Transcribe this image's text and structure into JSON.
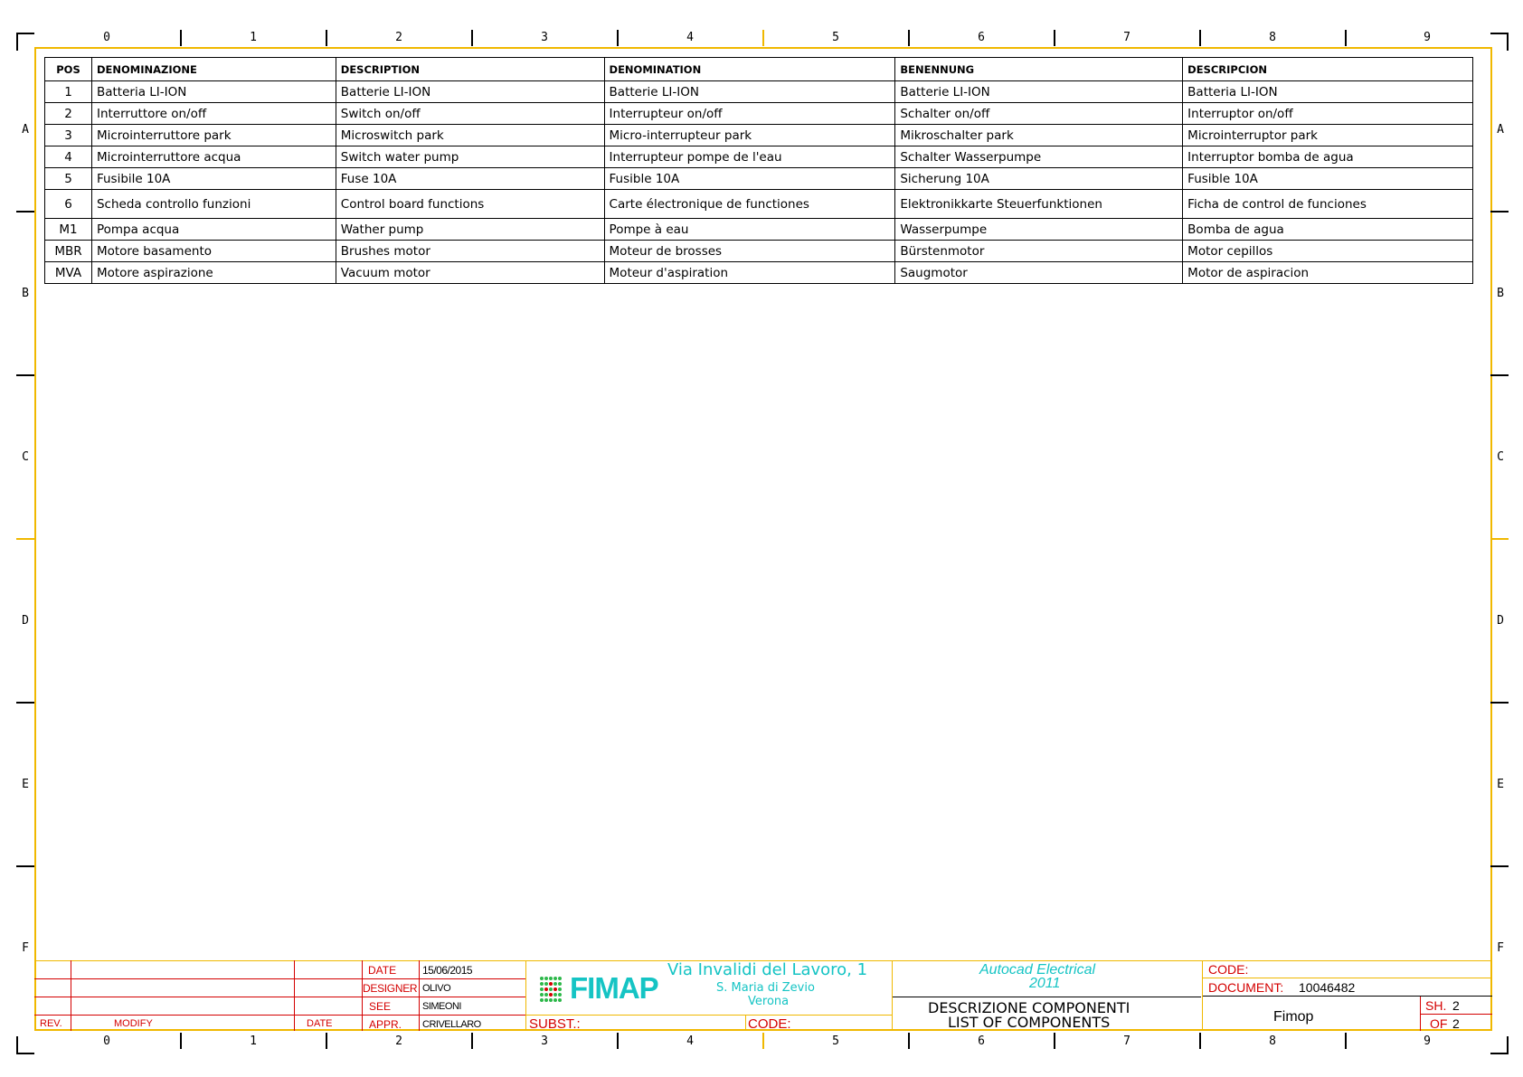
{
  "zones": {
    "columns": [
      "0",
      "1",
      "2",
      "3",
      "4",
      "5",
      "6",
      "7",
      "8",
      "9"
    ],
    "rows": [
      "A",
      "B",
      "C",
      "D",
      "E",
      "F"
    ]
  },
  "table": {
    "headers": [
      "POS",
      "DENOMINAZIONE",
      "DESCRIPTION",
      "DENOMINATION",
      "BENENNUNG",
      "DESCRIPCION"
    ],
    "rows": [
      [
        "1",
        "Batteria LI-ION",
        "Batterie LI-ION",
        "Batterie LI-ION",
        "Batterie LI-ION",
        "Batteria LI-ION"
      ],
      [
        "2",
        "Interruttore on/off",
        "Switch on/off",
        "Interrupteur on/off",
        "Schalter on/off",
        "Interruptor on/off"
      ],
      [
        "3",
        "Microinterruttore park",
        "Microswitch park",
        "Micro-interrupteur park",
        "Mikroschalter park",
        "Microinterruptor park"
      ],
      [
        "4",
        "Microinterruttore acqua",
        "Switch water pump",
        "Interrupteur pompe de l'eau",
        "Schalter Wasserpumpe",
        "Interruptor bomba de agua"
      ],
      [
        "5",
        "Fusibile 10A",
        "Fuse 10A",
        "Fusible 10A",
        "Sicherung  10A",
        "Fusible 10A"
      ],
      [
        "6",
        "Scheda controllo funzioni",
        "Control board functions",
        "Carte électronique de functiones",
        "Elektronikkarte  Steuerfunktionen",
        "Ficha de control de funciones"
      ],
      [
        "M1",
        "Pompa acqua",
        "Wather pump",
        "Pompe à eau",
        "Wasserpumpe",
        "Bomba de agua"
      ],
      [
        "MBR",
        "Motore basamento",
        "Brushes motor",
        "Moteur de brosses",
        "Bürstenmotor",
        "Motor cepillos"
      ],
      [
        "MVA",
        "Motore aspirazione",
        "Vacuum  motor",
        "Moteur d'aspiration",
        "Saugmotor",
        "Motor de aspiracion"
      ]
    ]
  },
  "title_block": {
    "rev_label": "REV.",
    "modify_label": "MODIFY",
    "date_col_label": "DATE",
    "date_label": "DATE",
    "date_value": "15/06/2015",
    "designer_label": "DESIGNER",
    "designer_value": "OLIVO",
    "see_label": "SEE",
    "see_value": "SIMEONI",
    "appr_label": "APPR.",
    "appr_value": "CRIVELLARO",
    "logo_text": "FIMAP",
    "address_line1": "Via  Invalidi  del  Lavoro,  1",
    "address_line2": "S.  Maria  di  Zevio",
    "address_line3": "Verona",
    "subst_label": "SUBST.:",
    "code_label_mid": "CODE:",
    "software_line1": "Autocad  Electrical",
    "software_line2": "2011",
    "title_line1": "DESCRIZIONE  COMPONENTI",
    "title_line2": "LIST  OF  COMPONENTS",
    "code_label": "CODE:",
    "document_label": "DOCUMENT:",
    "document_value": "10046482",
    "customer": "Fimop",
    "sheet_label": "SH.",
    "sheet_value": "2",
    "of_label": "OF",
    "of_value": "2"
  },
  "colors": {
    "frame": "#f0b800",
    "title_labels": "#d40000",
    "address_text": "#15c4c4",
    "logo_dots": "#2db84a"
  }
}
